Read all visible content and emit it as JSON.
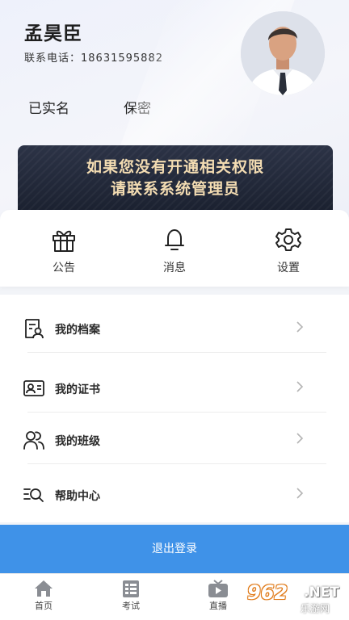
{
  "profile": {
    "name": "孟昊臣",
    "phone_label": "联系电话：",
    "phone": "18631595882",
    "verify_status": "已实名",
    "privacy": "保密"
  },
  "banner": {
    "line1": "如果您没有开通相关权限",
    "line2": "请联系系统管理员"
  },
  "quick_actions": [
    {
      "label": "公告",
      "icon": "gift-icon"
    },
    {
      "label": "消息",
      "icon": "bell-icon"
    },
    {
      "label": "设置",
      "icon": "gear-icon"
    }
  ],
  "menu": [
    {
      "label": "我的档案",
      "icon": "profile-file-icon"
    },
    {
      "label": "我的证书",
      "icon": "id-card-icon"
    },
    {
      "label": "我的班级",
      "icon": "group-icon"
    },
    {
      "label": "帮助中心",
      "icon": "search-list-icon"
    }
  ],
  "logout_label": "退出登录",
  "tabs": [
    {
      "label": "首页",
      "icon": "home-icon"
    },
    {
      "label": "考试",
      "icon": "exam-icon"
    },
    {
      "label": "直播",
      "icon": "tv-icon"
    }
  ],
  "watermark": {
    "logo": "962",
    "net": ".NET",
    "site": "乐游网"
  },
  "colors": {
    "accent": "#3f92e8",
    "banner_bg": "#1f2535",
    "banner_text": "#f3dcb2"
  }
}
